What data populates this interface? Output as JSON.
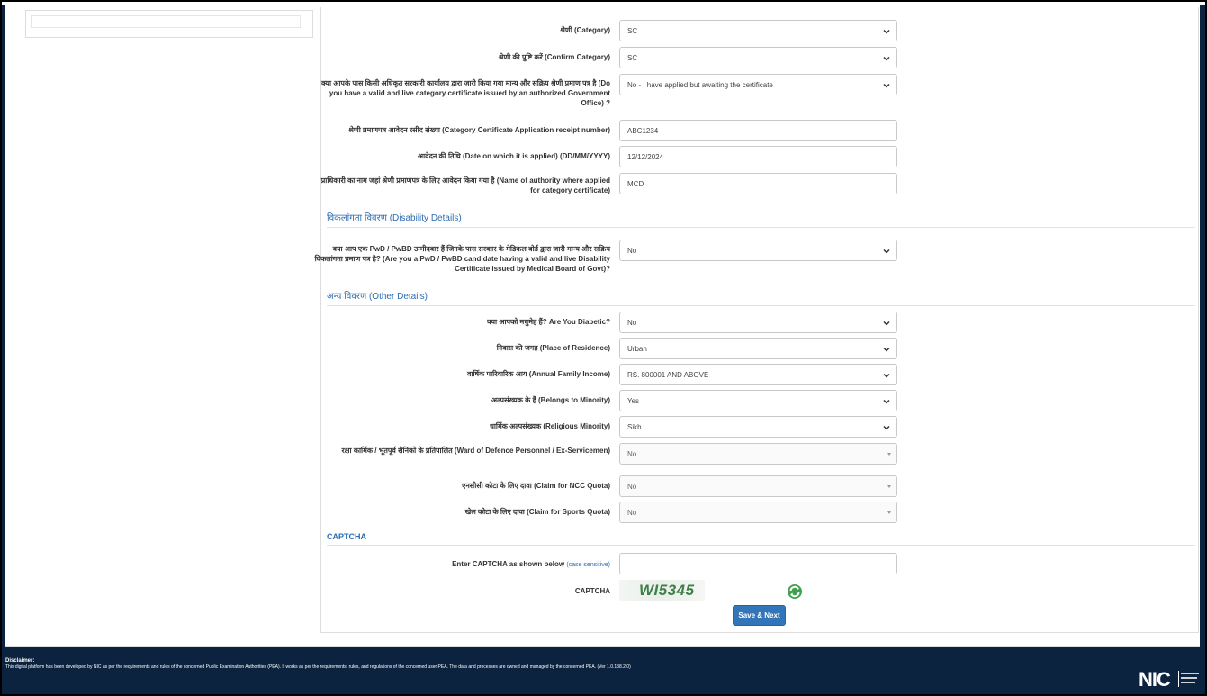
{
  "form": {
    "category": {
      "label": "श्रेणी (Category)",
      "value": "SC"
    },
    "confirm_category": {
      "label": "श्रेणी की पुष्टि करें (Confirm Category)",
      "value": "SC"
    },
    "category_certificate": {
      "label": "क्या आपके पास किसी अधिकृत सरकारी कार्यालय द्वारा जारी किया गया मान्य और सक्रिय श्रेणी प्रमाण पत्र है (Do you have a valid and live category certificate issued by an authorized Government Office) ?",
      "value": "No - I have applied but awaiting the certificate"
    },
    "receipt_number": {
      "label": "श्रेणी प्रमाणपत्र आवेदन रसीद संख्या (Category Certificate Application receipt number)",
      "value": "ABC1234"
    },
    "applied_date": {
      "label": "आवेदन की तिथि (Date on which it is applied) (DD/MM/YYYY)",
      "value": "12/12/2024"
    },
    "authority_name": {
      "label": "प्राधिकारी का नाम जहां श्रेणी प्रमाणपत्र के लिए आवेदन किया गया है (Name of authority where applied for category certificate)",
      "value": "MCD"
    }
  },
  "disability": {
    "heading": "विकलांगता विवरण (Disability Details)",
    "pwd": {
      "label": "क्या आप एक PwD / PwBD उम्मीदवार हैं जिनके पास सरकार के मेडिकल बोर्ड द्वारा जारी मान्य और सक्रिय विकलांगता प्रमाण पत्र है? (Are you a PwD / PwBD candidate having a valid and live Disability Certificate issued by Medical Board of Govt)?",
      "value": "No"
    }
  },
  "other": {
    "heading": "अन्य विवरण (Other Details)",
    "diabetic": {
      "label": "क्या आपको मधुमेह हैं? Are You Diabetic?",
      "value": "No"
    },
    "residence": {
      "label": "निवास की जगह (Place of Residence)",
      "value": "Urban"
    },
    "income": {
      "label": "वार्षिक पारिवारिक आय (Annual Family Income)",
      "value": "RS. 800001 AND ABOVE"
    },
    "minority": {
      "label": "अल्पसंख्यक के हैं (Belongs to Minority)",
      "value": "Yes"
    },
    "religious": {
      "label": "धार्मिक अल्पसंख्यक (Religious Minority)",
      "value": "Sikh"
    },
    "defence": {
      "label": "रक्षा कार्मिक / भूतपूर्व सैनिकों के प्रतिपालित (Ward of Defence Personnel / Ex-Servicemen)",
      "value": "No"
    },
    "ncc": {
      "label": "एनसीसी कोटा के लिए दावा (Claim for NCC Quota)",
      "value": "No"
    },
    "sports": {
      "label": "खेल कोटा के लिए दावा (Claim for Sports Quota)",
      "value": "No"
    }
  },
  "captcha": {
    "heading": "CAPTCHA",
    "enter_label": "Enter CAPTCHA as shown below",
    "hint": "(case sensitive)",
    "input_value": "",
    "image_label": "CAPTCHA",
    "image_text": "WI5345"
  },
  "actions": {
    "save_next": "Save & Next"
  },
  "footer": {
    "disclaimer_heading": "Disclaimer:",
    "disclaimer_text": "This digital platform has been developed by NIC as per the requirements and rules of the concerned Public Examination Authorities (PEA). It works as per the requirements, rules, and regulations of the concerned user PEA. The data and processes are owned and managed by the concerned PEA. (Ver 1.0.138.2.0)",
    "logo_text": "NIC"
  },
  "colors": {
    "accent": "#2b6cb0",
    "button": "#3375b9",
    "footer_bg": "#0c2340"
  }
}
